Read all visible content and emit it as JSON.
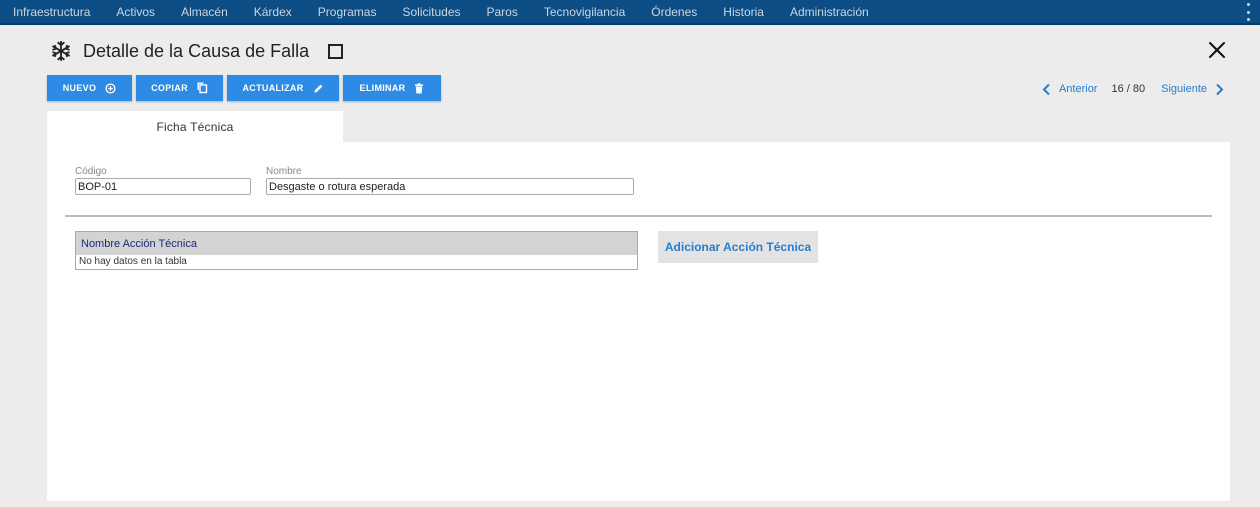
{
  "nav": {
    "items": [
      "Infraestructura",
      "Activos",
      "Almacén",
      "Kárdex",
      "Programas",
      "Solicitudes",
      "Paros",
      "Tecnovigilancia",
      "Órdenes",
      "Historia",
      "Administración"
    ]
  },
  "header": {
    "title": "Detalle de la Causa de Falla"
  },
  "toolbar": {
    "nuevo": "NUEVO",
    "copiar": "COPIAR",
    "actualizar": "ACTUALIZAR",
    "eliminar": "ELIMINAR"
  },
  "pager": {
    "prev": "Anterior",
    "count": "16 / 80",
    "next": "Siguiente"
  },
  "tabs": {
    "ficha": "Ficha Técnica"
  },
  "form": {
    "codigo_label": "Código",
    "codigo_value": "BOP-01",
    "nombre_label": "Nombre",
    "nombre_value": "Desgaste o rotura esperada"
  },
  "table": {
    "header": "Nombre Acción Técnica",
    "empty": "No hay datos en la tabla"
  },
  "actions": {
    "add": "Adicionar Acción Técnica"
  },
  "colors": {
    "nav_bg": "#0d4d86",
    "button_blue": "#2d8be6",
    "link_blue": "#2a7dc9"
  },
  "icons": {
    "title": "snowflake-icon",
    "close": "close-icon"
  }
}
